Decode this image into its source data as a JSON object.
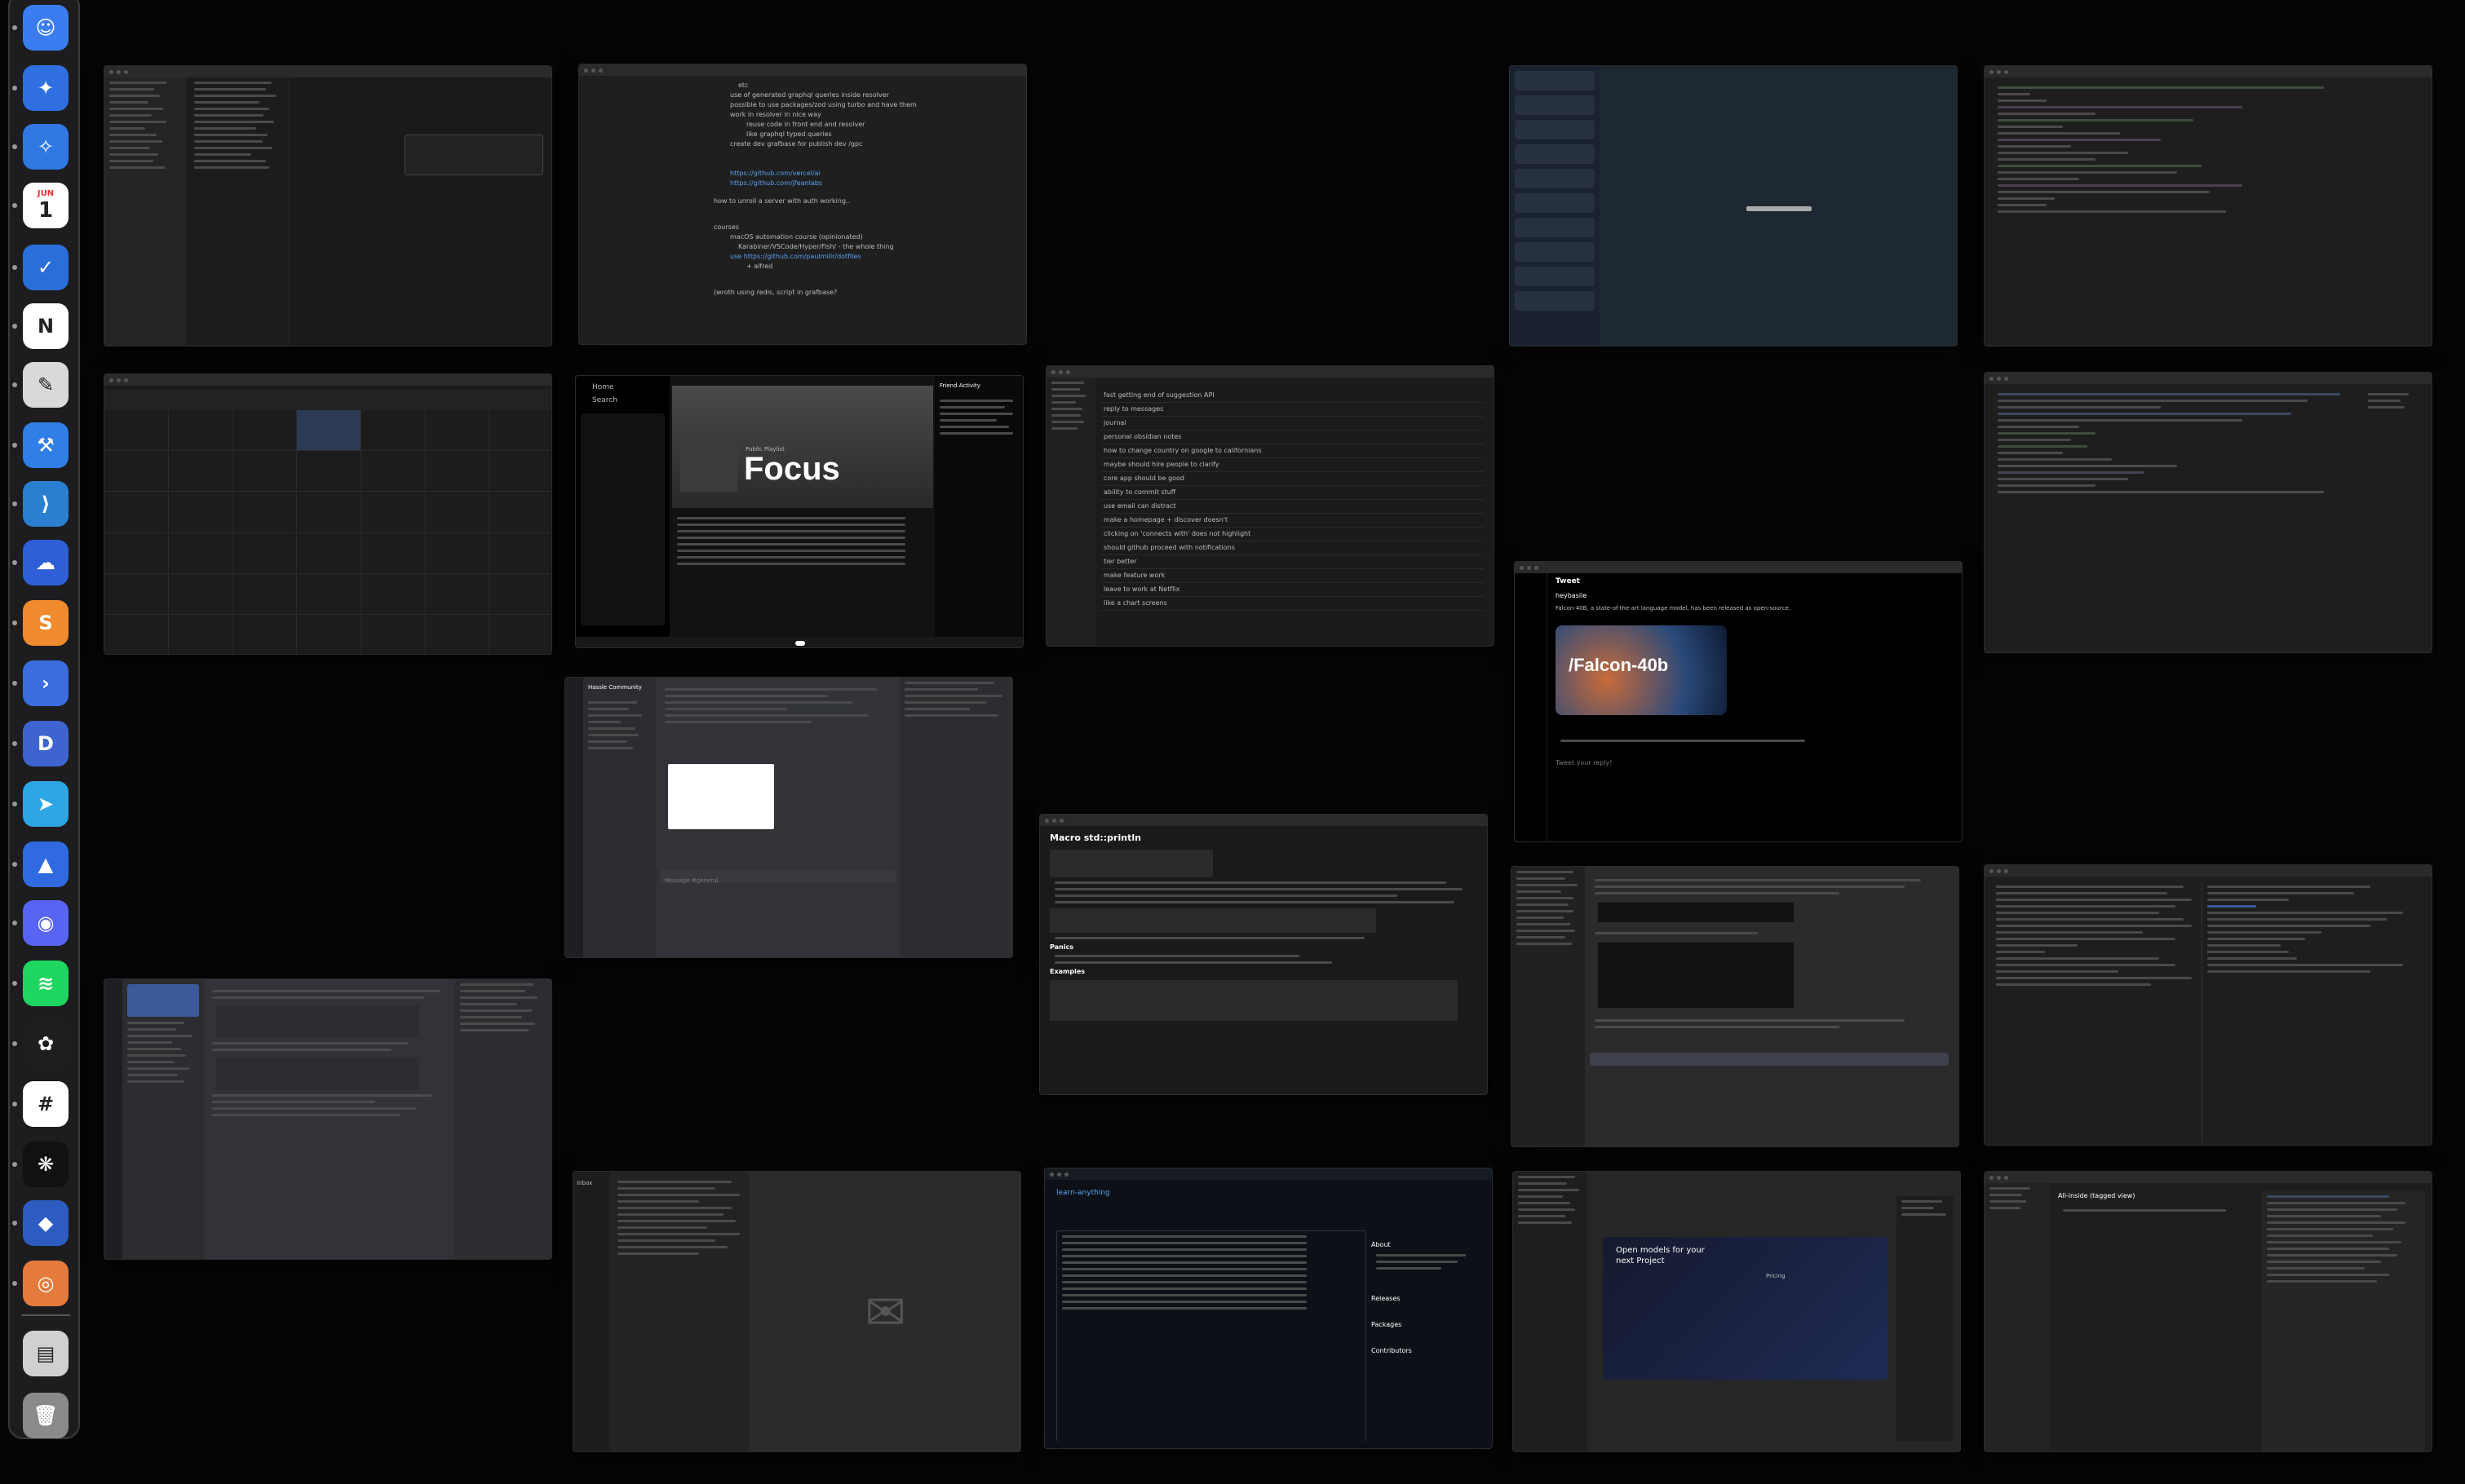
{
  "dock": {
    "calendar_month": "JUN",
    "calendar_day": "1",
    "icons": [
      {
        "name": "finder-icon",
        "color": "#3b7df0",
        "glyph": "☺"
      },
      {
        "name": "safari-icon",
        "color": "#2f6fe0",
        "glyph": "✦"
      },
      {
        "name": "safari-technology-preview-icon",
        "color": "#3178e4",
        "glyph": "✧"
      },
      {
        "name": "calendar-icon",
        "color": "#ffffff",
        "glyph": ""
      },
      {
        "name": "things-icon",
        "color": "#2a6fd9",
        "glyph": "✓"
      },
      {
        "name": "notion-icon",
        "color": "#ffffff",
        "glyph": "N"
      },
      {
        "name": "script-editor-icon",
        "color": "#d9d9d9",
        "glyph": "✎"
      },
      {
        "name": "xcode-icon",
        "color": "#2f7fe6",
        "glyph": "⚒"
      },
      {
        "name": "vscode-icon",
        "color": "#2a7fd0",
        "glyph": "⟩"
      },
      {
        "name": "cloud-app-icon",
        "color": "#2e5fd6",
        "glyph": "☁"
      },
      {
        "name": "sublime-text-icon",
        "color": "#ef8a2e",
        "glyph": "S"
      },
      {
        "name": "prompt-ssh-icon",
        "color": "#3c6ddf",
        "glyph": "›"
      },
      {
        "name": "dash-icon",
        "color": "#3e64d0",
        "glyph": "D"
      },
      {
        "name": "telegram-icon",
        "color": "#2ea6e3",
        "glyph": "➤"
      },
      {
        "name": "spark-mail-icon",
        "color": "#2f6ae0",
        "glyph": "▲"
      },
      {
        "name": "discord-icon",
        "color": "#5865f2",
        "glyph": "◉"
      },
      {
        "name": "spotify-icon",
        "color": "#1ed760",
        "glyph": "≋"
      },
      {
        "name": "figma-icon",
        "color": "#1e1e1e",
        "glyph": "✿"
      },
      {
        "name": "slack-icon",
        "color": "#ffffff",
        "glyph": "#"
      },
      {
        "name": "chatgpt-icon",
        "color": "#111111",
        "glyph": "❋"
      },
      {
        "name": "xcode-instruments-icon",
        "color": "#2d5cc0",
        "glyph": "◆"
      },
      {
        "name": "orion-browser-icon",
        "color": "#e47a3c",
        "glyph": "◎"
      },
      {
        "name": "downloads-stack-icon",
        "color": "#d0d0d0",
        "glyph": "▤"
      },
      {
        "name": "trash-icon",
        "color": "#8a8a8a",
        "glyph": "🗑"
      }
    ]
  },
  "windows": {
    "notes": {
      "lines": [
        "etc",
        "use of generated graphql queries inside resolver",
        "possible to use packages/zod using turbo and have them",
        "work in resolver in nice way",
        "reuse code in front end and resolver",
        "like graphql typed queries",
        "create dev grafbase for publish dev /gpc",
        "https://github.com/vercel/ai",
        "https://github.com/jfeanlabs",
        "how to unroll a server with auth working..",
        "courses",
        "macOS automation course (opinionated)",
        "Karabiner/VSCode/Hyper/Fish/ - the whole thing",
        "use https://github.com/paulmillr/dotfiles",
        "+ alfred",
        "(wroth using redis, script in grafbase?"
      ]
    },
    "spotify": {
      "home": "Home",
      "search": "Search",
      "playlist_label": "Public Playlist",
      "playlist_title": "Focus",
      "friend_activity": "Friend Activity"
    },
    "tweet": {
      "header": "Tweet",
      "author": "heybasile",
      "body": "Falcon-40B, a state-of-the-art language model, has been released as open-source.",
      "card_title": "/Falcon-40b",
      "reply_placeholder": "Tweet your reply!"
    },
    "discord": {
      "server": "Hassle Community",
      "channel": "general",
      "message_placeholder": "Message #general"
    },
    "rust_docs": {
      "title": "Macro std::println",
      "section_panics": "Panics",
      "section_examples": "Examples"
    },
    "mail": {
      "inbox_label": "Inbox"
    },
    "github": {
      "repo": "learn-anything",
      "about_label": "About",
      "releases_label": "Releases",
      "packages_label": "Packages",
      "contributors_label": "Contributors"
    },
    "midjourney": {
      "headline": "Open models for your next Project",
      "sub_label": "Pricing"
    },
    "tasks": {
      "title": "All-inside (tagged view)",
      "items": [
        "fast getting end of suggestion API",
        "reply to messages",
        "journal",
        "personal obsidian notes",
        "how to change country on google to californians",
        "maybe should hire people to clarify",
        "core app should be good",
        "ability to commit stuff",
        "use email can distract",
        "make a homepage + discover doesn't",
        "clicking on 'connects with' does not highlight",
        "should github proceed with notifications",
        "tier better",
        "make feature work",
        "leave to work at Netflix",
        "like a chart screens"
      ]
    }
  }
}
